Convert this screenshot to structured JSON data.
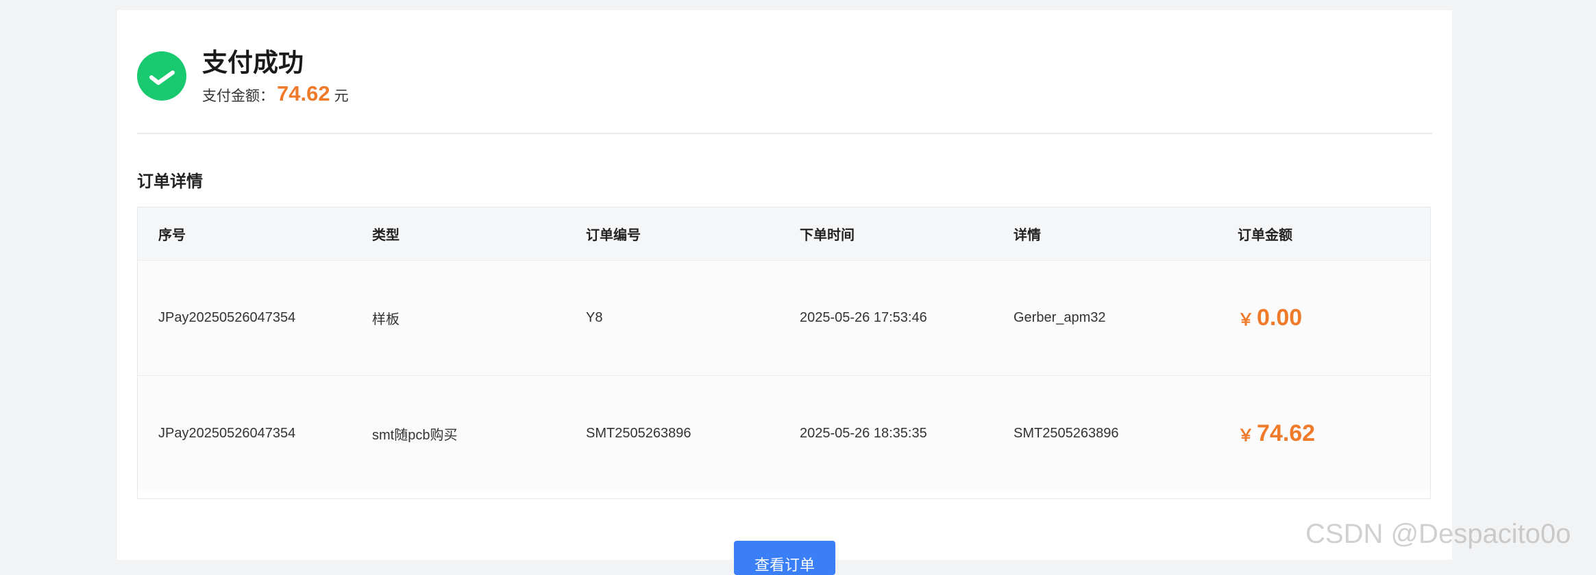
{
  "header": {
    "title": "支付成功",
    "amount_label": "支付金额：",
    "amount_value": "74.62",
    "amount_unit": "元",
    "icon": "check-circle-icon"
  },
  "section": {
    "title": "订单详情"
  },
  "table": {
    "columns": [
      "序号",
      "类型",
      "订单编号",
      "下单时间",
      "详情",
      "订单金额"
    ],
    "rows": [
      {
        "seq": "JPay20250526047354",
        "type": "样板",
        "order_no": "Y8",
        "time": "2025-05-26 17:53:46",
        "detail": "Gerber_apm32",
        "currency": "￥",
        "amount": "0.00"
      },
      {
        "seq": "JPay20250526047354",
        "type": "smt随pcb购买",
        "order_no": "SMT2505263896",
        "time": "2025-05-26 18:35:35",
        "detail": "SMT2505263896",
        "currency": "￥",
        "amount": "74.62"
      }
    ]
  },
  "actions": {
    "view_order_label": "查看订单"
  },
  "watermark": "CSDN @Despacito0o",
  "colors": {
    "success": "#19c96f",
    "price": "#ef7a2a",
    "primary_button": "#3a7ff6",
    "background": "#f2f3f5"
  }
}
